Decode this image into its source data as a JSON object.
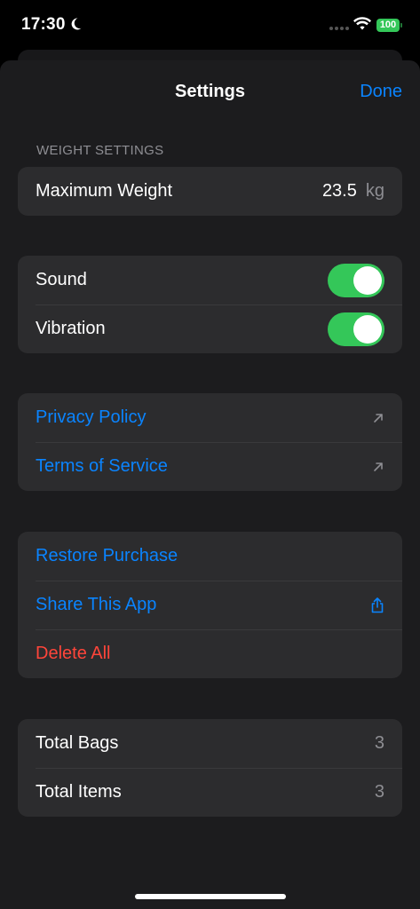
{
  "status_bar": {
    "time": "17:30",
    "battery": "100"
  },
  "nav": {
    "title": "Settings",
    "done_label": "Done"
  },
  "weight_settings": {
    "header": "WEIGHT SETTINGS",
    "max_weight_label": "Maximum Weight",
    "max_weight_value": "23.5",
    "unit": "kg"
  },
  "feedback": {
    "sound_label": "Sound",
    "sound_on": true,
    "vibration_label": "Vibration",
    "vibration_on": true
  },
  "legal": {
    "privacy_label": "Privacy Policy",
    "terms_label": "Terms of Service"
  },
  "actions": {
    "restore_label": "Restore Purchase",
    "share_label": "Share This App",
    "delete_label": "Delete All"
  },
  "stats": {
    "total_bags_label": "Total Bags",
    "total_bags_value": "3",
    "total_items_label": "Total Items",
    "total_items_value": "3"
  },
  "colors": {
    "accent": "#0a84ff",
    "danger": "#ff453a",
    "toggle_on": "#34c759",
    "background": "#1c1c1e",
    "group_background": "#2c2c2e"
  }
}
